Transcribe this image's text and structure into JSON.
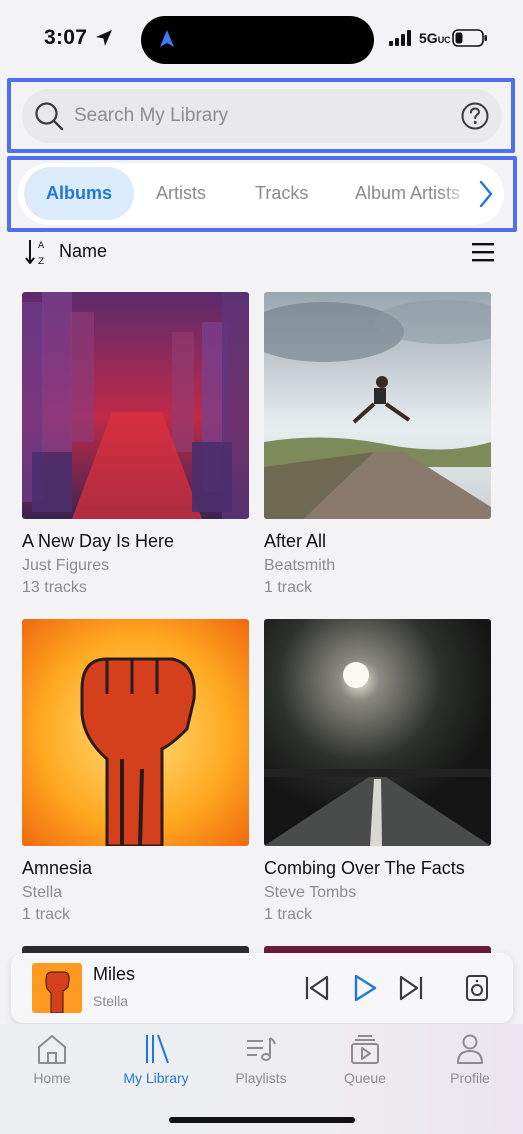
{
  "status_bar": {
    "time": "3:07",
    "network": "5G",
    "network_suffix": "UC"
  },
  "search": {
    "placeholder": "Search My Library",
    "value": ""
  },
  "tabs": [
    {
      "label": "Albums",
      "active": true
    },
    {
      "label": "Artists",
      "active": false
    },
    {
      "label": "Tracks",
      "active": false
    },
    {
      "label": "Album Artists",
      "active": false
    }
  ],
  "sort": {
    "label": "Name"
  },
  "albums": [
    {
      "title": "A New Day Is Here",
      "artist": "Just Figures",
      "tracks": "13 tracks"
    },
    {
      "title": "After All",
      "artist": "Beatsmith",
      "tracks": "1 track"
    },
    {
      "title": "Amnesia",
      "artist": "Stella",
      "tracks": "1 track"
    },
    {
      "title": "Combing Over The Facts",
      "artist": "Steve Tombs",
      "tracks": "1 track"
    }
  ],
  "now_playing": {
    "title": "Miles",
    "artist": "Stella"
  },
  "tab_bar": [
    {
      "label": "Home",
      "icon": "home-icon",
      "active": false
    },
    {
      "label": "My Library",
      "icon": "library-icon",
      "active": true
    },
    {
      "label": "Playlists",
      "icon": "playlists-icon",
      "active": false
    },
    {
      "label": "Queue",
      "icon": "queue-icon",
      "active": false
    },
    {
      "label": "Profile",
      "icon": "profile-icon",
      "active": false
    }
  ],
  "colors": {
    "accent": "#1f77d8",
    "highlight_frame": "#4f6fee",
    "active_tab_bg": "#dcebfb"
  }
}
